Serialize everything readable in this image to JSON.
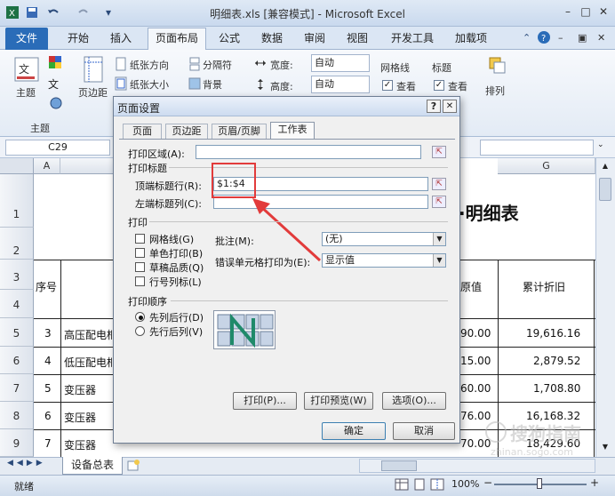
{
  "window": {
    "title": "明细表.xls  [兼容模式] - Microsoft Excel",
    "minimize_glyph": "–",
    "maximize_glyph": "□",
    "close_glyph": "✕"
  },
  "ribbon_tabs": [
    "文件",
    "开始",
    "插入",
    "页面布局",
    "公式",
    "数据",
    "审阅",
    "视图",
    "开发工具",
    "加载项"
  ],
  "ribbon": {
    "themes_label": "主题",
    "themes_group_label": "主题",
    "margins_label": "页边距",
    "orientation_label": "纸张方向",
    "size_label": "纸张大小",
    "breaks_label": "分隔符",
    "background_label": "背景",
    "width_label": "宽度:",
    "width_value": "自动",
    "height_label": "高度:",
    "height_value": "自动",
    "gridlines_label": "网格线",
    "headings_label": "标题",
    "view_label": "查看",
    "view_label2": "查看",
    "arrange_label": "排列"
  },
  "formula_bar": {
    "name_box": "C29"
  },
  "grid": {
    "col_a": "A",
    "col_g": "G",
    "rows": [
      "1",
      "2",
      "3",
      "4",
      "5",
      "6",
      "7",
      "8",
      "9"
    ],
    "title_fragment": "·明细表",
    "header_seq": "序号",
    "header_value": "原值",
    "header_depr": "累计折旧",
    "data": [
      {
        "seq": "3",
        "name": "高压配电柜",
        "value": "90.00",
        "depr": "19,616.16"
      },
      {
        "seq": "4",
        "name": "低压配电柜",
        "value": "15.00",
        "depr": "2,879.52"
      },
      {
        "seq": "5",
        "name": "变压器",
        "value": "60.00",
        "depr": "1,708.80"
      },
      {
        "seq": "6",
        "name": "变压器",
        "value": "76.00",
        "depr": "16,168.32"
      },
      {
        "seq": "7",
        "name": "变压器",
        "value": "70.00",
        "depr": "18,429.60"
      }
    ]
  },
  "sheet_tabs": {
    "active": "设备总表"
  },
  "status": {
    "ready": "就绪",
    "zoom": "100%",
    "zoom_minus": "−",
    "zoom_plus": "+"
  },
  "dialog": {
    "title": "页面设置",
    "help": "?",
    "close": "✕",
    "tabs": [
      "页面",
      "页边距",
      "页眉/页脚",
      "工作表"
    ],
    "print_area_label": "打印区域(A):",
    "print_titles_label": "打印标题",
    "top_rows_label": "顶端标题行(R):",
    "top_rows_value": "$1:$4",
    "left_cols_label": "左端标题列(C):",
    "print_label": "打印",
    "gridlines": "网格线(G)",
    "single_color": "单色打印(B)",
    "draft_quality": "草稿品质(Q)",
    "row_col_headers": "行号列标(L)",
    "comments_label": "批注(M):",
    "comments_value": "(无)",
    "errors_label": "错误单元格打印为(E):",
    "errors_value": "显示值",
    "page_order_label": "打印顺序",
    "down_then_over": "先列后行(D)",
    "over_then_down": "先行后列(V)",
    "print_button": "打印(P)...",
    "preview_button": "打印预览(W)",
    "options_button": "选项(O)...",
    "ok_button": "确定",
    "cancel_button": "取消"
  },
  "watermark": {
    "text": "搜狗指南",
    "sub": "zhinan.sogo.com"
  },
  "colors": {
    "file_tab": "#2a6cb8",
    "highlight": "#e23b3b"
  }
}
